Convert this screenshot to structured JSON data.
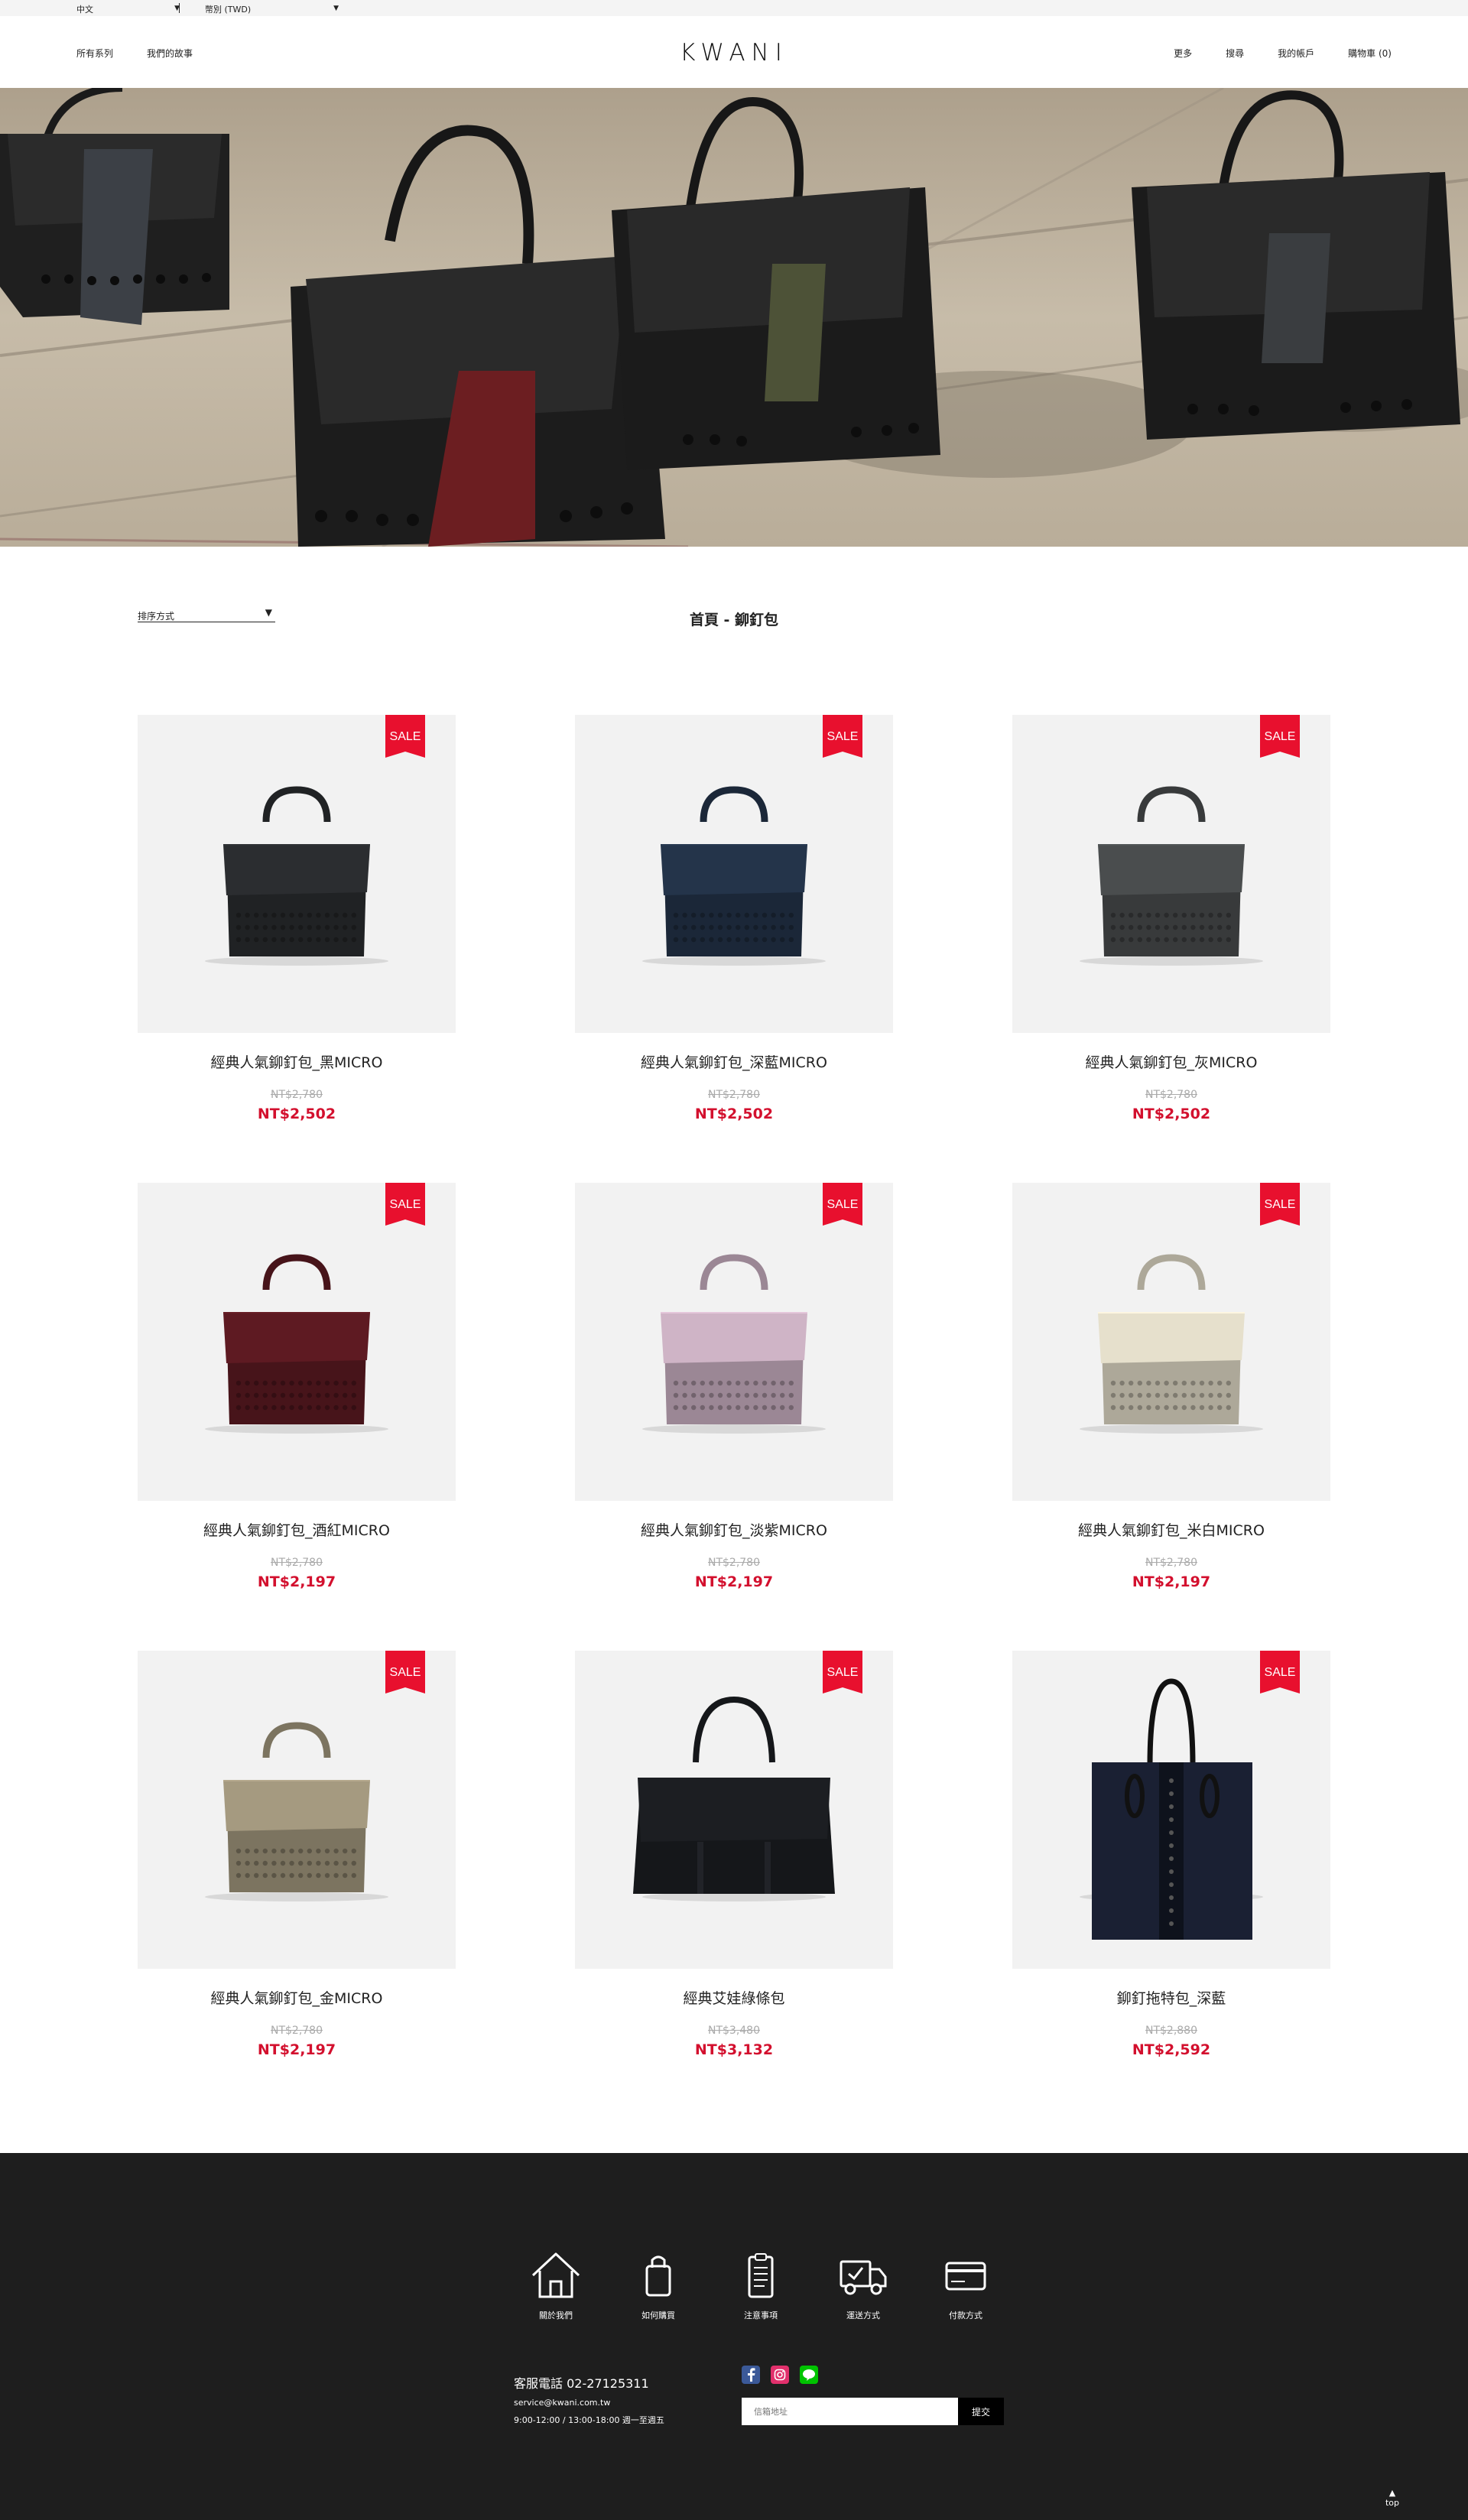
{
  "topbar": {
    "language": "中文",
    "currency": "幣別 (TWD)"
  },
  "header": {
    "logo": "KWANI",
    "nav_left": [
      "所有系列",
      "我們的故事"
    ],
    "nav_right": [
      "更多",
      "搜尋",
      "我的帳戶",
      "購物車 (0)"
    ]
  },
  "toolbar": {
    "sort_label": "排序方式",
    "breadcrumb": "首頁 - 鉚釘包"
  },
  "products": [
    {
      "name": "經典人氣鉚釘包_黑MICRO",
      "old_price": "NT$2,780",
      "price": "NT$2,502",
      "badge": "SALE",
      "color": "#2b2d30",
      "type": "rivet"
    },
    {
      "name": "經典人氣鉚釘包_深藍MICRO",
      "old_price": "NT$2,780",
      "price": "NT$2,502",
      "badge": "SALE",
      "color": "#24344a",
      "type": "rivet"
    },
    {
      "name": "經典人氣鉚釘包_灰MICRO",
      "old_price": "NT$2,780",
      "price": "NT$2,502",
      "badge": "SALE",
      "color": "#4a4d4e",
      "type": "rivet"
    },
    {
      "name": "經典人氣鉚釘包_酒紅MICRO",
      "old_price": "NT$2,780",
      "price": "NT$2,197",
      "badge": "SALE",
      "color": "#5e1a22",
      "type": "rivet"
    },
    {
      "name": "經典人氣鉚釘包_淡紫MICRO",
      "old_price": "NT$2,780",
      "price": "NT$2,197",
      "badge": "SALE",
      "color": "#cfb4c6",
      "type": "rivet"
    },
    {
      "name": "經典人氣鉚釘包_米白MICRO",
      "old_price": "NT$2,780",
      "price": "NT$2,197",
      "badge": "SALE",
      "color": "#e6e0cc",
      "type": "rivet"
    },
    {
      "name": "經典人氣鉚釘包_金MICRO",
      "old_price": "NT$2,780",
      "price": "NT$2,197",
      "badge": "SALE",
      "color": "#a59a80",
      "type": "rivet"
    },
    {
      "name": "經典艾娃綠條包",
      "old_price": "NT$3,480",
      "price": "NT$3,132",
      "badge": "SALE",
      "color": "#1c1e22",
      "type": "wide"
    },
    {
      "name": "鉚釘拖特包_深藍",
      "old_price": "NT$2,880",
      "price": "NT$2,592",
      "badge": "SALE",
      "color": "#1a2033",
      "type": "tote"
    }
  ],
  "footer": {
    "icons": [
      {
        "label": "關於我們",
        "icon": "home-icon"
      },
      {
        "label": "如何購買",
        "icon": "shopping-bag-icon"
      },
      {
        "label": "注意事項",
        "icon": "clipboard-icon"
      },
      {
        "label": "運送方式",
        "icon": "delivery-truck-icon"
      },
      {
        "label": "付款方式",
        "icon": "credit-card-icon"
      }
    ],
    "phone": "客服電話 02-27125311",
    "email": "service@kwani.com.tw",
    "hours": "9:00-12:00 / 13:00-18:00 週一至週五",
    "email_placeholder": "信箱地址",
    "submit": "提交",
    "to_top": "top",
    "colors": {
      "facebook": "#3b5998",
      "instagram": "#e1306c",
      "line": "#00c300"
    }
  },
  "colors": {
    "sale_red": "#e8102e",
    "price_red": "#d3102e",
    "footer_bg": "#1e1e1e"
  }
}
